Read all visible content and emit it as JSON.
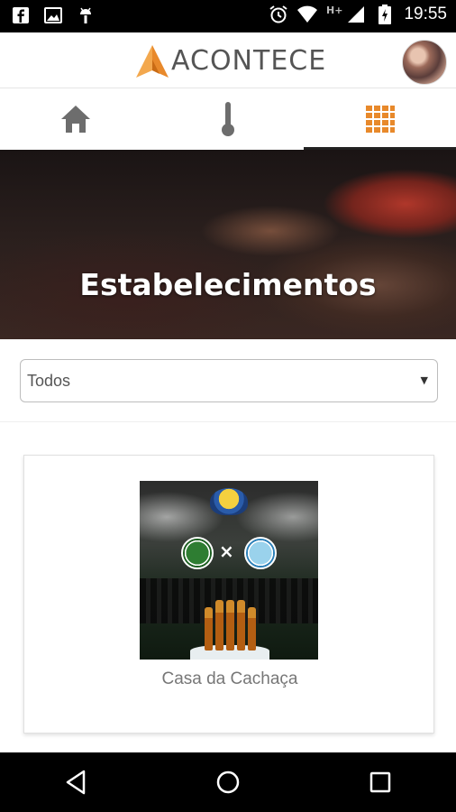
{
  "status_bar": {
    "time": "19:55",
    "network": "H+",
    "icons": [
      "facebook-icon",
      "image-icon",
      "android-icon",
      "alarm-icon",
      "wifi-icon",
      "signal-icon",
      "battery-icon"
    ]
  },
  "header": {
    "logo_text": "ACONTECE",
    "logo_color": "#e8892b",
    "avatar": "profile-photo"
  },
  "tabs": [
    {
      "icon": "home-icon",
      "active": false
    },
    {
      "icon": "thermometer-icon",
      "active": false
    },
    {
      "icon": "grid-icon",
      "active": true
    }
  ],
  "hero": {
    "title": "Estabelecimentos"
  },
  "filter": {
    "selected": "Todos"
  },
  "cards": [
    {
      "title": "Casa da Cachaça"
    }
  ],
  "nav_bar": {
    "icons": [
      "back-icon",
      "home-circle-icon",
      "recents-icon"
    ]
  },
  "colors": {
    "accent": "#e8892b",
    "tab_icon": "#6d6d6d",
    "active_indicator": "#222222"
  }
}
